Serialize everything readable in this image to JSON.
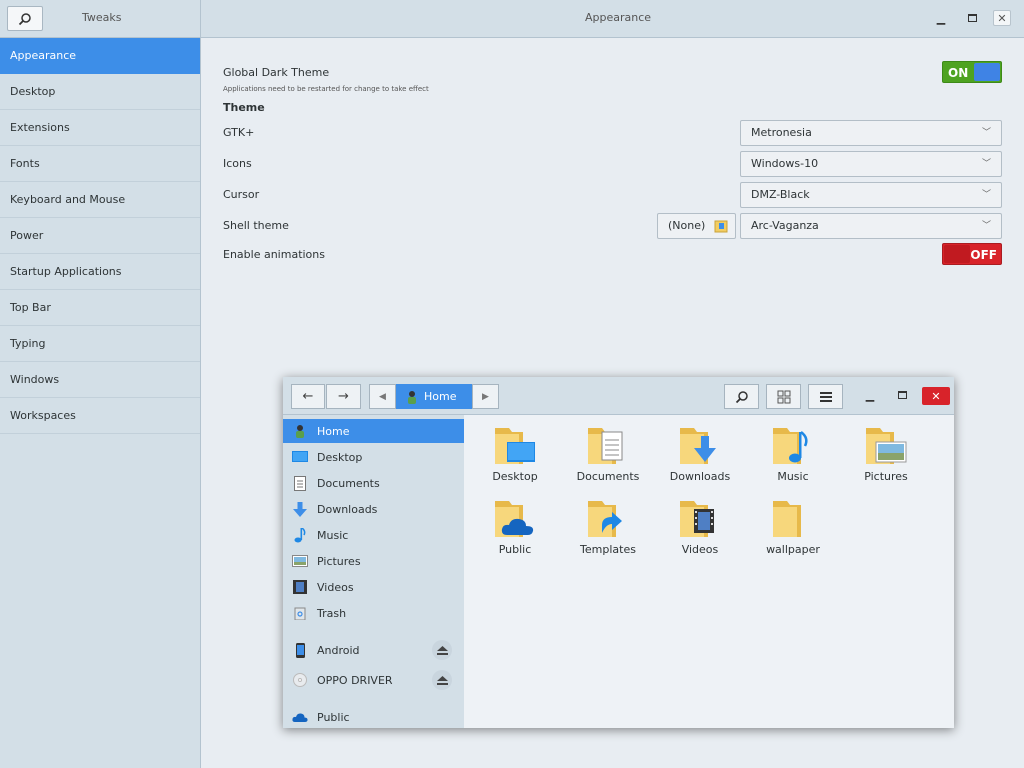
{
  "tweaks": {
    "app_title": "Tweaks",
    "page_title": "Appearance",
    "sidebar": [
      {
        "label": "Appearance",
        "active": true
      },
      {
        "label": "Desktop"
      },
      {
        "label": "Extensions"
      },
      {
        "label": "Fonts"
      },
      {
        "label": "Keyboard and Mouse"
      },
      {
        "label": "Power"
      },
      {
        "label": "Startup Applications"
      },
      {
        "label": "Top Bar"
      },
      {
        "label": "Typing"
      },
      {
        "label": "Windows"
      },
      {
        "label": "Workspaces"
      }
    ],
    "settings": {
      "global_dark_label": "Global Dark Theme",
      "global_dark_note": "Applications need to be restarted for change to take effect",
      "global_dark_state": "ON",
      "theme_section": "Theme",
      "gtk_label": "GTK+",
      "gtk_value": "Metronesia",
      "icons_label": "Icons",
      "icons_value": "Windows-10",
      "cursor_label": "Cursor",
      "cursor_value": "DMZ-Black",
      "shell_label": "Shell theme",
      "shell_none": "(None)",
      "shell_value": "Arc-Vaganza",
      "animations_label": "Enable animations",
      "animations_state": "OFF"
    }
  },
  "files": {
    "path_current": "Home",
    "sidebar_places": [
      {
        "label": "Home",
        "icon": "home-icon"
      },
      {
        "label": "Desktop",
        "icon": "desktop-icon"
      },
      {
        "label": "Documents",
        "icon": "documents-icon"
      },
      {
        "label": "Downloads",
        "icon": "downloads-icon"
      },
      {
        "label": "Music",
        "icon": "music-icon"
      },
      {
        "label": "Pictures",
        "icon": "pictures-icon"
      },
      {
        "label": "Videos",
        "icon": "videos-icon"
      },
      {
        "label": "Trash",
        "icon": "trash-icon"
      }
    ],
    "devices": [
      {
        "label": "Android",
        "icon": "phone-icon"
      },
      {
        "label": "OPPO DRIVER",
        "icon": "disc-icon"
      }
    ],
    "network": [
      {
        "label": "Public",
        "icon": "cloud-icon"
      }
    ],
    "folders": [
      {
        "label": "Desktop"
      },
      {
        "label": "Documents"
      },
      {
        "label": "Downloads"
      },
      {
        "label": "Music"
      },
      {
        "label": "Pictures"
      },
      {
        "label": "Public"
      },
      {
        "label": "Templates"
      },
      {
        "label": "Videos"
      },
      {
        "label": "wallpaper"
      }
    ]
  },
  "colors": {
    "accent": "#3d8ee8",
    "switch_on": "#4ea321",
    "switch_off": "#d8232a",
    "folder": "#f2cd62"
  }
}
